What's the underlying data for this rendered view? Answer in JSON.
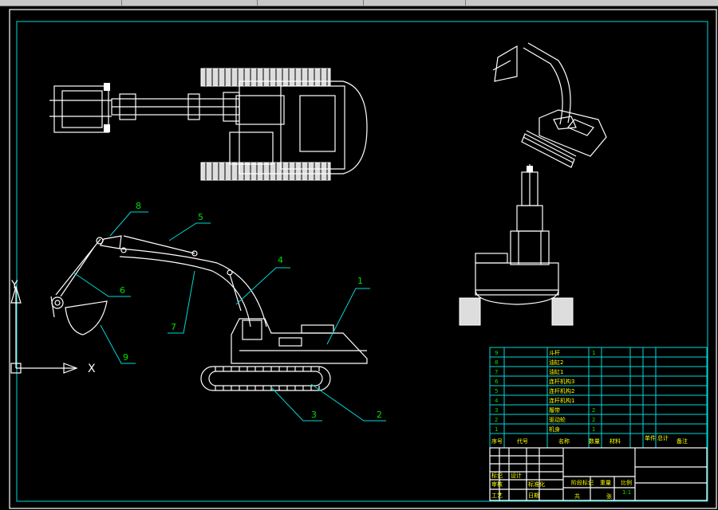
{
  "toolbar": {
    "label": "CAD toolbar"
  },
  "axes": {
    "y_label": "Y",
    "x_label": "X"
  },
  "balloons": [
    {
      "num": "1"
    },
    {
      "num": "2"
    },
    {
      "num": "3"
    },
    {
      "num": "4"
    },
    {
      "num": "5"
    },
    {
      "num": "6"
    },
    {
      "num": "7"
    },
    {
      "num": "8"
    },
    {
      "num": "9"
    }
  ],
  "parts_list": {
    "rows": [
      {
        "no": "9",
        "name": "斗杆",
        "qty": "1"
      },
      {
        "no": "8",
        "name": "油缸2",
        "qty": ""
      },
      {
        "no": "7",
        "name": "油缸1",
        "qty": ""
      },
      {
        "no": "6",
        "name": "连杆机构3",
        "qty": ""
      },
      {
        "no": "5",
        "name": "连杆机构2",
        "qty": ""
      },
      {
        "no": "4",
        "name": "连杆机构1",
        "qty": ""
      },
      {
        "no": "3",
        "name": "履带",
        "qty": "2"
      },
      {
        "no": "2",
        "name": "驱动轮",
        "qty": "2"
      },
      {
        "no": "1",
        "name": "机身",
        "qty": "1"
      }
    ],
    "header": {
      "c1": "序号",
      "c2": "代号",
      "c3": "名称",
      "c4": "数量",
      "c5": "材料",
      "c6": "单件",
      "c7": "总计",
      "c8": "备注"
    }
  },
  "title_block": {
    "r1": "标记",
    "r2": "设计",
    "r3": "审核",
    "r4": "工艺",
    "std": "标准化",
    "date": "日期",
    "stage": "阶段标记",
    "weight": "重量",
    "scale": "比例",
    "scale_val": "1:1",
    "sheet": "共",
    "of": "张"
  }
}
